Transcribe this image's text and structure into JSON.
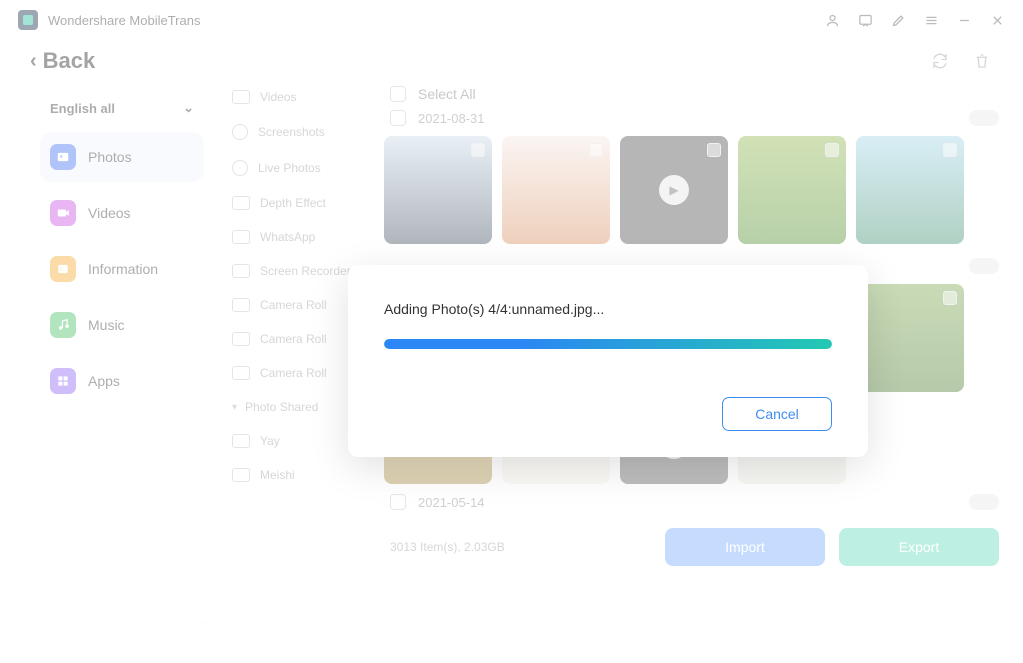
{
  "app": {
    "title": "Wondershare MobileTrans"
  },
  "header": {
    "back_label": "Back"
  },
  "sidebar": {
    "filter_label": "English all",
    "items": [
      {
        "label": "Photos"
      },
      {
        "label": "Videos"
      },
      {
        "label": "Information"
      },
      {
        "label": "Music"
      },
      {
        "label": "Apps"
      }
    ]
  },
  "subnav": {
    "items": [
      {
        "label": "Videos"
      },
      {
        "label": "Screenshots"
      },
      {
        "label": "Live Photos"
      },
      {
        "label": "Depth Effect"
      },
      {
        "label": "WhatsApp"
      },
      {
        "label": "Screen Recorder"
      },
      {
        "label": "Camera Roll"
      },
      {
        "label": "Camera Roll"
      },
      {
        "label": "Camera Roll"
      },
      {
        "label": "Photo Shared"
      },
      {
        "label": "Yay"
      },
      {
        "label": "Meishi"
      }
    ]
  },
  "grid": {
    "select_all_label": "Select All",
    "groups": [
      {
        "date": "2021-08-31"
      },
      {
        "date": "2021-05-14"
      }
    ],
    "footer_info": "3013 Item(s), 2.03GB",
    "import_label": "Import",
    "export_label": "Export"
  },
  "modal": {
    "message": "Adding Photo(s) 4/4:unnamed.jpg...",
    "cancel_label": "Cancel"
  }
}
